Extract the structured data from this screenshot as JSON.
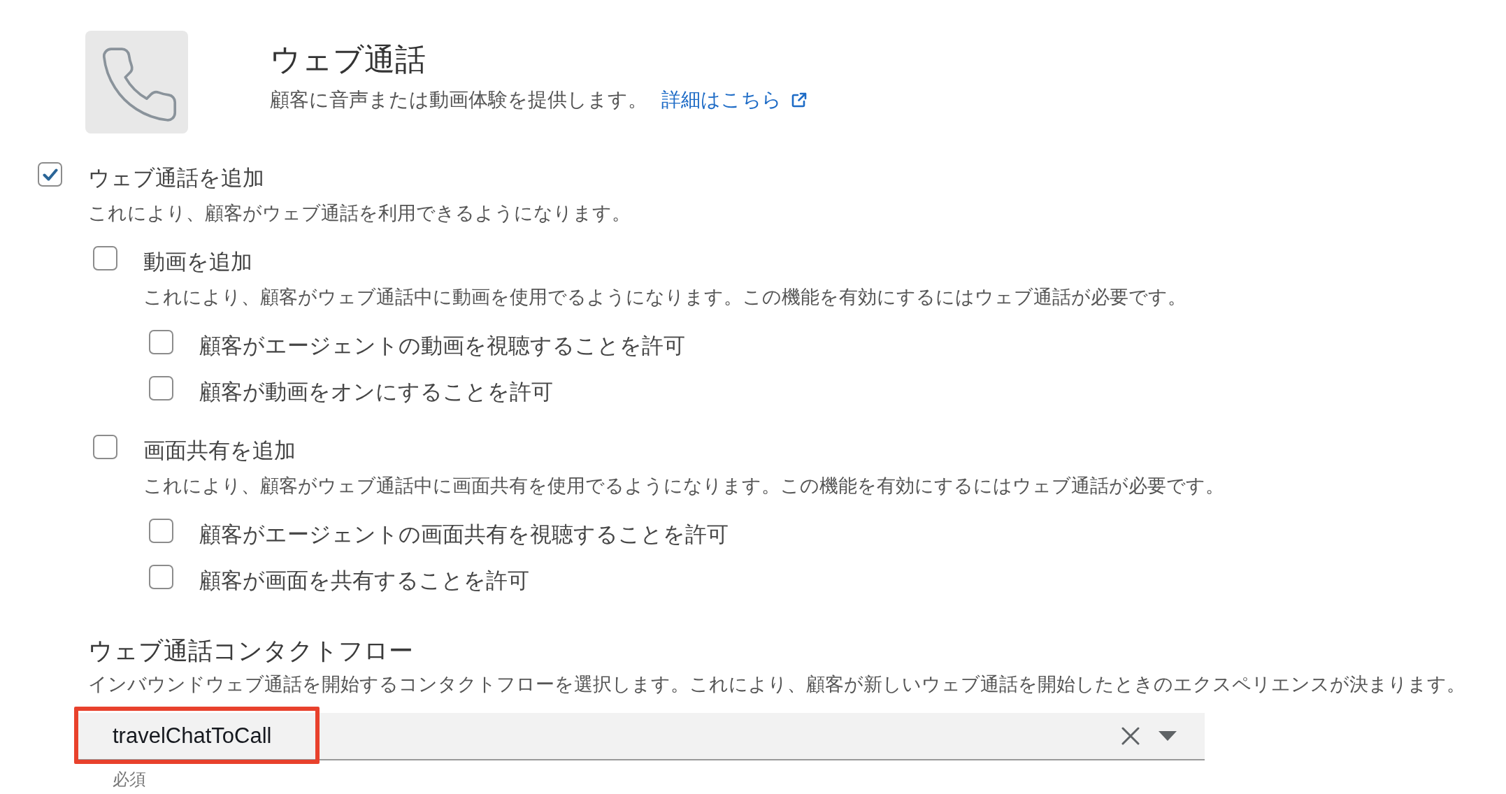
{
  "header": {
    "title": "ウェブ通話",
    "description": "顧客に音声または動画体験を提供します。",
    "link": "詳細はこちら"
  },
  "options": [
    {
      "label": "ウェブ通話を追加",
      "description": "これにより、顧客がウェブ通話を利用できるようになります。",
      "checked": true,
      "children": [
        {
          "label": "動画を追加",
          "description": "これにより、顧客がウェブ通話中に動画を使用でるようになります。この機能を有効にするにはウェブ通話が必要です。",
          "checked": false,
          "children": [
            {
              "label": "顧客がエージェントの動画を視聴することを許可",
              "checked": false
            },
            {
              "label": "顧客が動画をオンにすることを許可",
              "checked": false
            }
          ]
        },
        {
          "label": "画面共有を追加",
          "description": "これにより、顧客がウェブ通話中に画面共有を使用でるようになります。この機能を有効にするにはウェブ通話が必要です。",
          "checked": false,
          "children": [
            {
              "label": "顧客がエージェントの画面共有を視聴することを許可",
              "checked": false
            },
            {
              "label": "顧客が画面を共有することを許可",
              "checked": false
            }
          ]
        }
      ]
    }
  ],
  "contact_flow": {
    "title": "ウェブ通話コンタクトフロー",
    "description": "インバウンドウェブ通話を開始するコンタクトフローを選択します。これにより、顧客が新しいウェブ通話を開始したときのエクスペリエンスが決まります。",
    "select": {
      "value": "travelChatToCall",
      "highlighted": true
    },
    "hint": "必須"
  }
}
